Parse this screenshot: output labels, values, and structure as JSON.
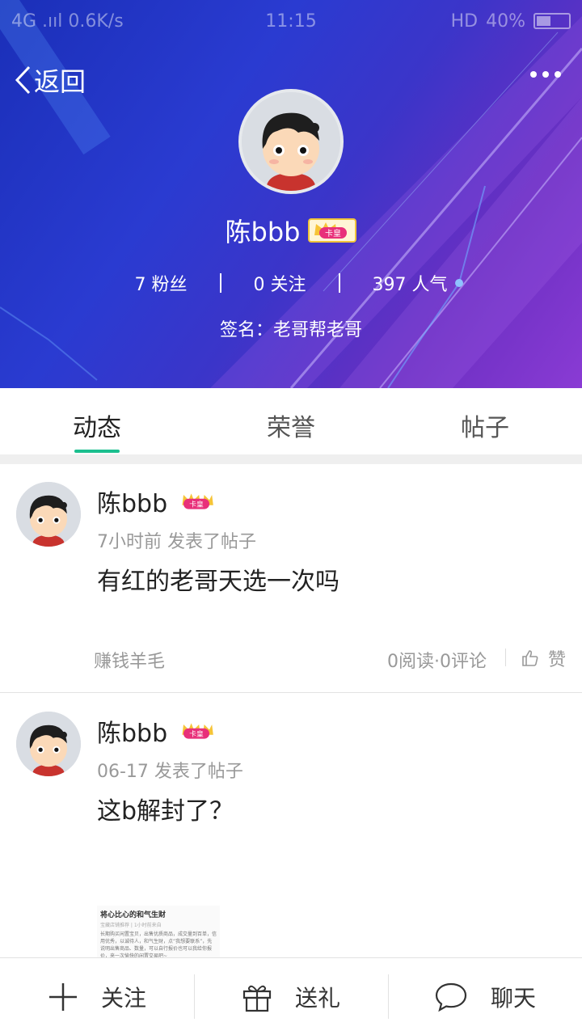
{
  "status_bar": {
    "network": "4G .ııl",
    "speed": "0.6K/s",
    "time": "11:15",
    "right": "HD",
    "battery": "40%"
  },
  "header": {
    "back_label": "返回",
    "username": "陈bbb",
    "badge_text": "卡皇",
    "stats": {
      "fans": "7 粉丝",
      "follow": "0 关注",
      "popularity": "397 人气"
    },
    "signature": "签名：老哥帮老哥"
  },
  "tabs": [
    {
      "label": "动态",
      "active": true
    },
    {
      "label": "荣誉",
      "active": false
    },
    {
      "label": "帖子",
      "active": false
    }
  ],
  "posts": [
    {
      "username": "陈bbb",
      "badge_text": "卡皇",
      "meta": "7小时前  发表了帖子",
      "content": "有红的老哥天选一次吗",
      "tag": "赚钱羊毛",
      "counts": "0阅读·0评论",
      "like_label": "赞"
    },
    {
      "username": "陈bbb",
      "badge_text": "卡皇",
      "meta": "06-17  发表了帖子",
      "content": "这b解封了？",
      "thumb": {
        "title": "将心比心的和气生财",
        "subtitle": "宝藏店铺推荐 | 1小时前来自",
        "body": "长期购买闲置宝贝，出售优质商品，成交量到百单，信用优秀，以诚待人，和气生财，点“我想要联系”，先说明出售商品、数量，可以自行报价也可以我给你报价，来一次愉快的闲置交易吧~"
      }
    }
  ],
  "bottom_bar": {
    "follow_label": "关注",
    "gift_label": "送礼",
    "chat_label": "聊天"
  },
  "colors": {
    "accent": "#1bbf8f",
    "header_gradient_start": "#1a2fb8",
    "header_gradient_end": "#8a3bd4"
  }
}
